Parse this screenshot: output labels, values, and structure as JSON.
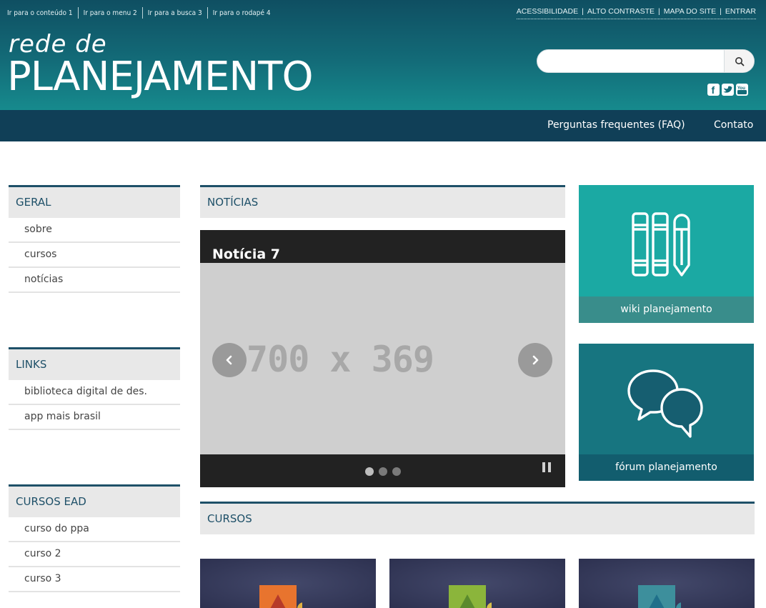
{
  "header": {
    "skip_links": [
      "Ir para o conteúdo 1",
      "Ir para o menu 2",
      "Ir para a busca 3",
      "Ir para o rodapé 4"
    ],
    "top_links": [
      "ACESSIBILIDADE",
      "ALTO CONTRASTE",
      "MAPA DO SITE",
      "ENTRAR"
    ],
    "logo_small": "rede de",
    "logo_big": "PLANEJAMENTO",
    "search": {
      "placeholder": "",
      "value": "",
      "button_icon": "search-icon"
    },
    "social_icons": [
      "facebook-icon",
      "twitter-icon",
      "youtube-icon"
    ]
  },
  "nav": {
    "faq": "Perguntas frequentes (FAQ)",
    "contact": "Contato"
  },
  "sidebar": {
    "geral": {
      "title": "GERAL",
      "items": [
        "sobre",
        "cursos",
        "notícias"
      ]
    },
    "links": {
      "title": "LINKS",
      "items": [
        "biblioteca digital de des.",
        "app mais brasil"
      ]
    },
    "ead": {
      "title": "CURSOS EAD",
      "items": [
        "curso do ppa",
        "curso 2",
        "curso 3"
      ]
    }
  },
  "news": {
    "title": "NOTÍCIAS",
    "slide_title": "Notícia 7",
    "placeholder": "700 x 369",
    "dots": 3,
    "active_dot": 1
  },
  "tiles": {
    "wiki": {
      "label": "wiki planejamento",
      "color": "#1ba9a3",
      "label_bg": "#398d8b"
    },
    "forum": {
      "label": "fórum planejamento",
      "color": "#177580",
      "label_bg": "#125d6e"
    }
  },
  "courses": {
    "title": "CURSOS",
    "cards": [
      {
        "accent": "#e8742e",
        "triangle": "#b63a2a"
      },
      {
        "accent": "#8bb53b",
        "triangle": "#5a8a2d"
      },
      {
        "accent": "#3d8f9c",
        "triangle": "#1f6f8a"
      }
    ]
  },
  "colors": {
    "header_dark": "#0f4f62",
    "header_light": "#168a8d",
    "nav": "#103f57",
    "accent_border": "#1e5068"
  }
}
